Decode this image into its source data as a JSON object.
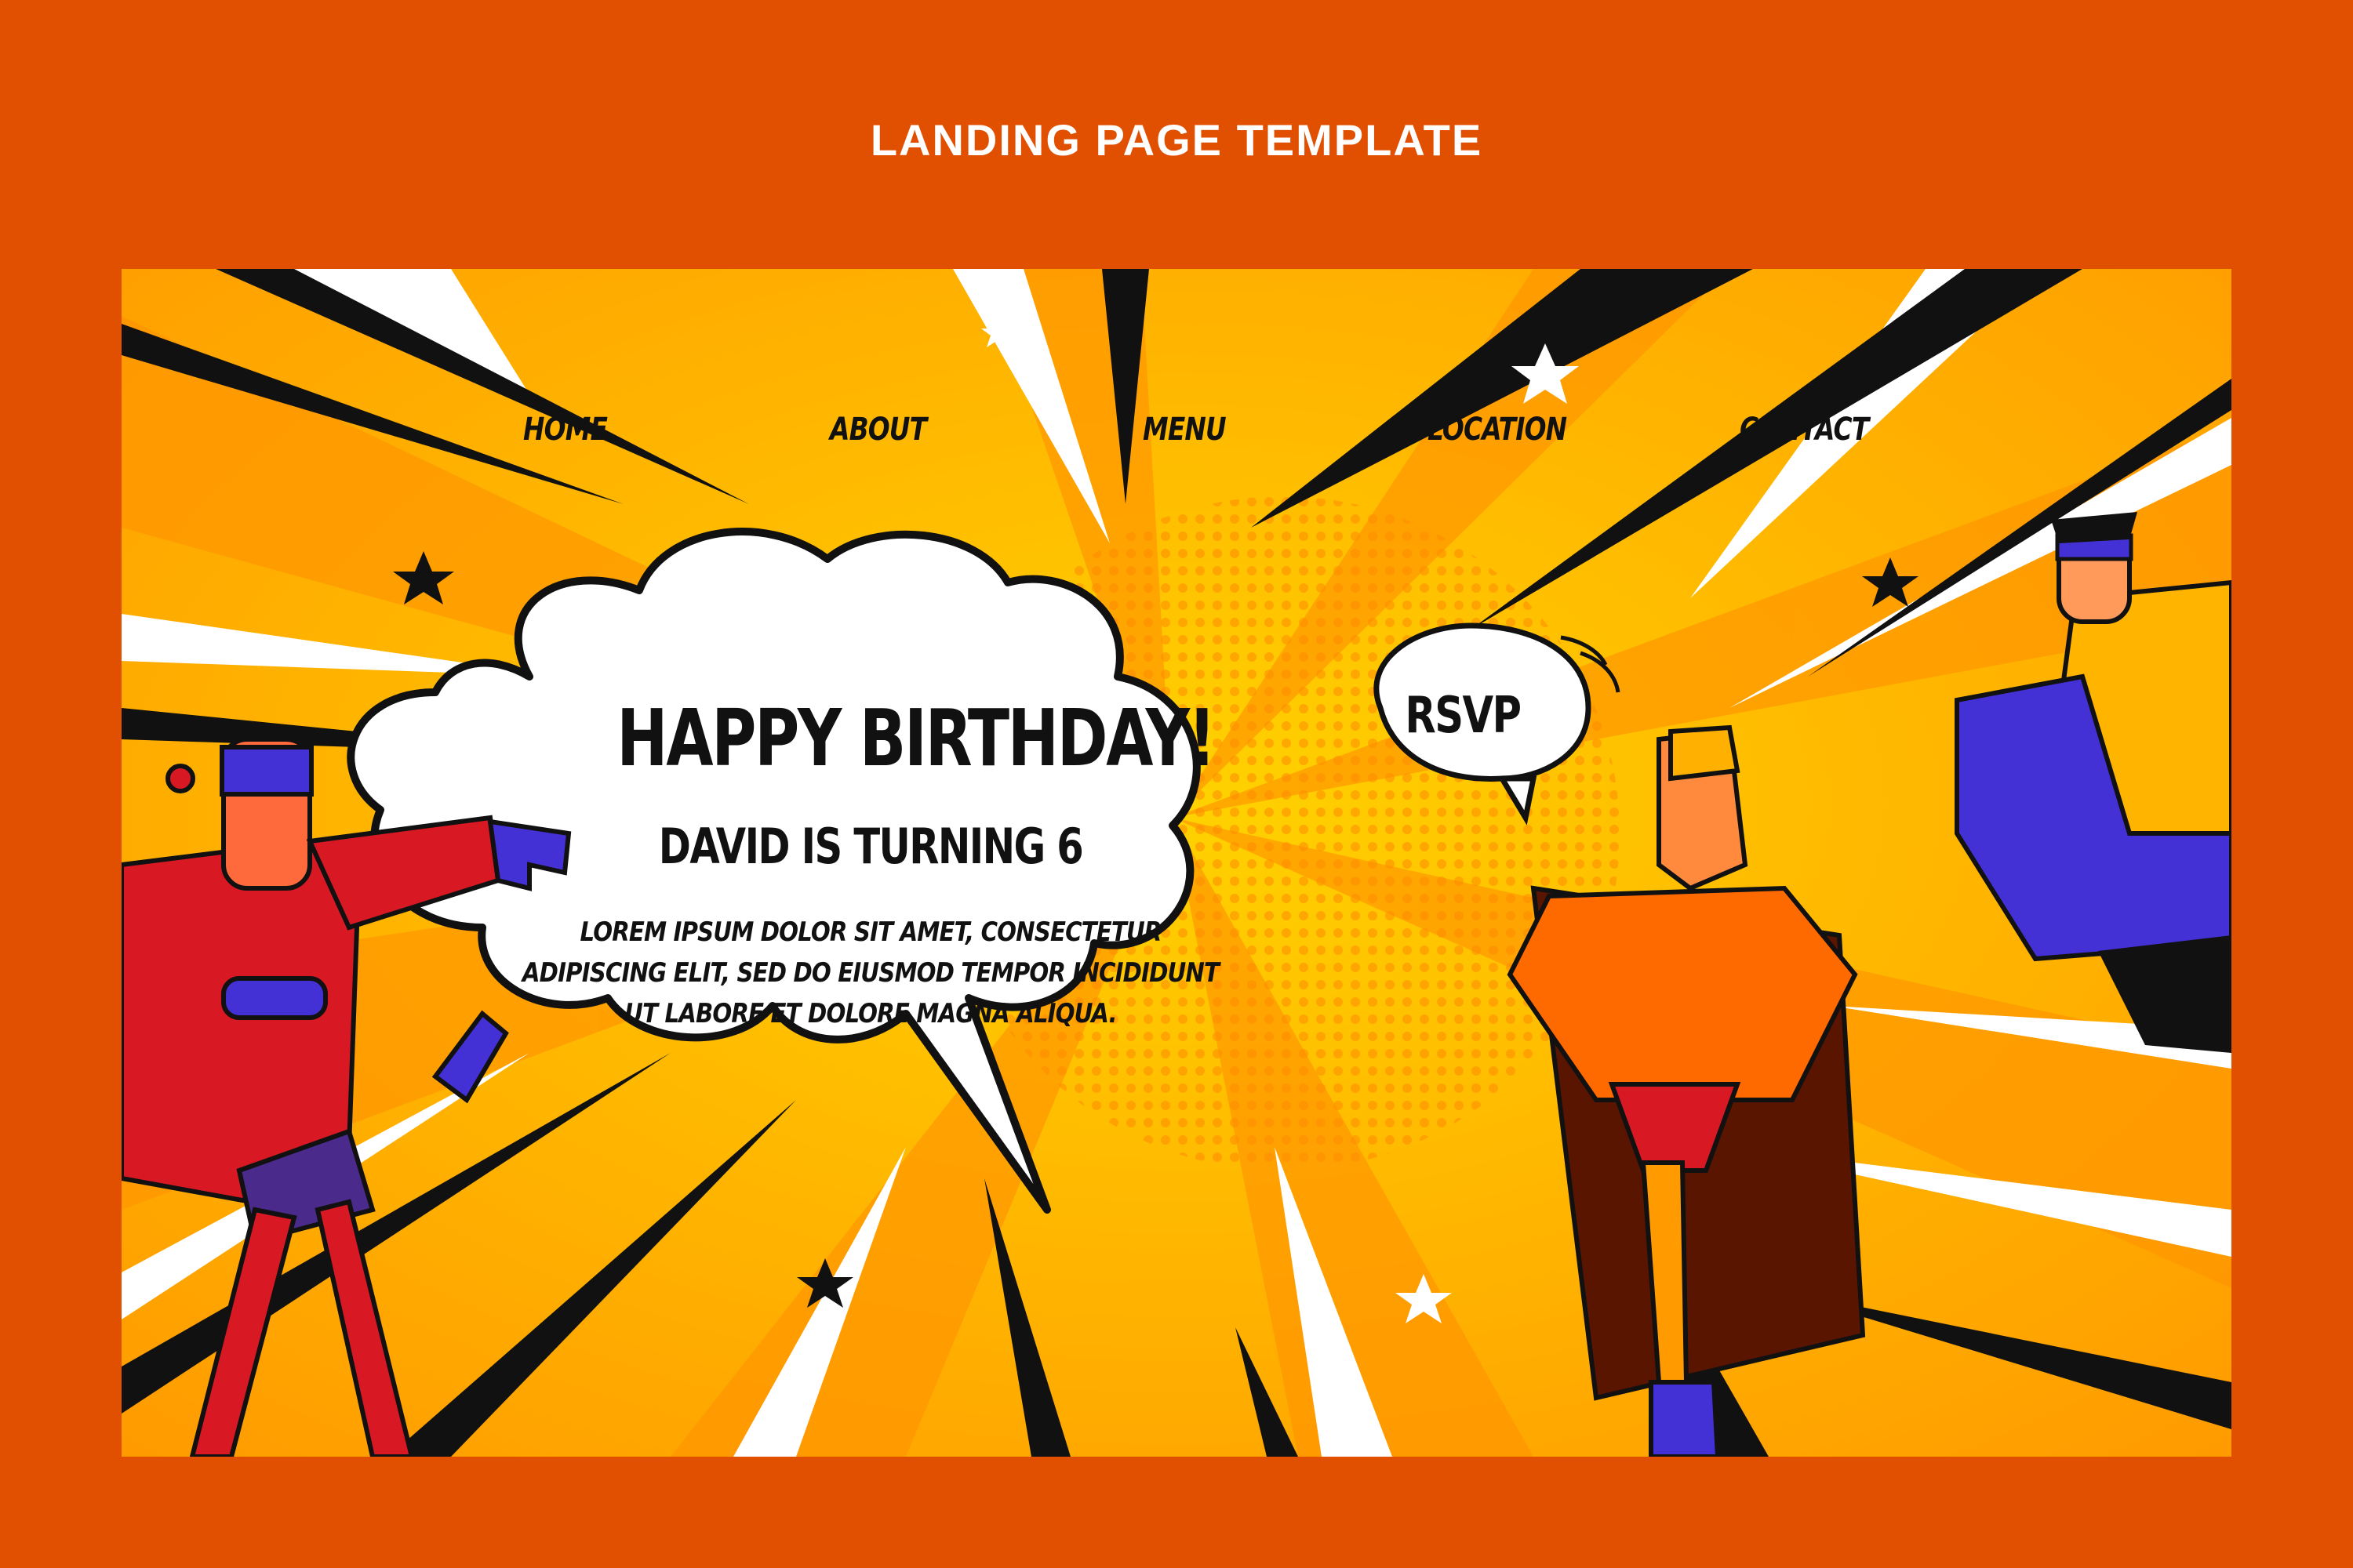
{
  "header": {
    "title": "LANDING PAGE TEMPLATE"
  },
  "nav": {
    "items": [
      {
        "label": "HOME"
      },
      {
        "label": "ABOUT"
      },
      {
        "label": "MENU"
      },
      {
        "label": "LOCATION"
      },
      {
        "label": "CONTACT"
      }
    ]
  },
  "hero": {
    "headline": "HAPPY BIRTHDAY!",
    "subheadline": "DAVID IS TURNING 6",
    "body": "LOREM IPSUM DOLOR SIT AMET, CONSECTETUR ADIPISCING ELIT, SED DO EIUSMOD TEMPOR INCIDIDUNT UT LABORE ET DOLORE MAGNA ALIQUA.",
    "cta_label": "RSVP"
  },
  "colors": {
    "page_background": "#e14f00",
    "panel_yellow": "#ffb400",
    "bubble_white": "#ffffff",
    "ink": "#111111"
  },
  "icons": [
    "star-icon"
  ]
}
